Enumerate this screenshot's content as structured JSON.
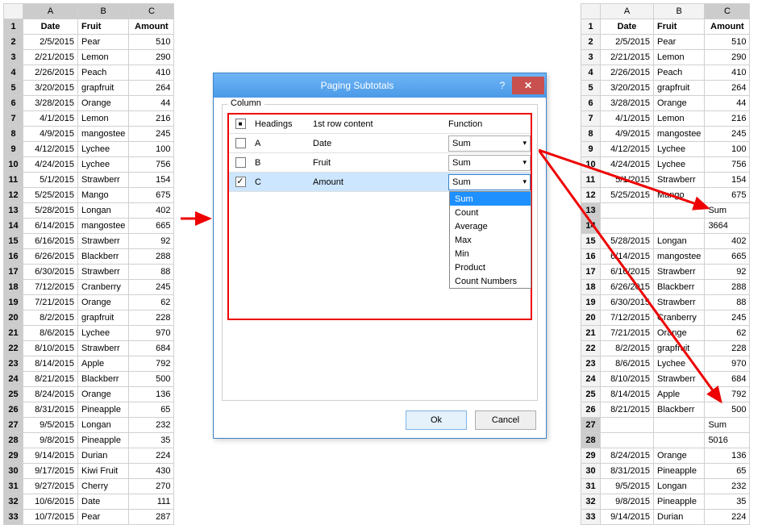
{
  "left_sheet": {
    "columns": [
      "A",
      "B",
      "C"
    ],
    "headers": [
      "Date",
      "Fruit",
      "Amount"
    ],
    "rows": [
      {
        "n": 2,
        "date": "2/5/2015",
        "fruit": "Pear",
        "amount": 510
      },
      {
        "n": 3,
        "date": "2/21/2015",
        "fruit": "Lemon",
        "amount": 290
      },
      {
        "n": 4,
        "date": "2/26/2015",
        "fruit": "Peach",
        "amount": 410
      },
      {
        "n": 5,
        "date": "3/20/2015",
        "fruit": "grapfruit",
        "amount": 264
      },
      {
        "n": 6,
        "date": "3/28/2015",
        "fruit": "Orange",
        "amount": 44
      },
      {
        "n": 7,
        "date": "4/1/2015",
        "fruit": "Lemon",
        "amount": 216
      },
      {
        "n": 8,
        "date": "4/9/2015",
        "fruit": "mangostee",
        "amount": 245
      },
      {
        "n": 9,
        "date": "4/12/2015",
        "fruit": "Lychee",
        "amount": 100
      },
      {
        "n": 10,
        "date": "4/24/2015",
        "fruit": "Lychee",
        "amount": 756
      },
      {
        "n": 11,
        "date": "5/1/2015",
        "fruit": "Strawberr",
        "amount": 154
      },
      {
        "n": 12,
        "date": "5/25/2015",
        "fruit": "Mango",
        "amount": 675
      },
      {
        "n": 13,
        "date": "5/28/2015",
        "fruit": "Longan",
        "amount": 402
      },
      {
        "n": 14,
        "date": "6/14/2015",
        "fruit": "mangostee",
        "amount": 665
      },
      {
        "n": 15,
        "date": "6/16/2015",
        "fruit": "Strawberr",
        "amount": 92
      },
      {
        "n": 16,
        "date": "6/26/2015",
        "fruit": "Blackberr",
        "amount": 288
      },
      {
        "n": 17,
        "date": "6/30/2015",
        "fruit": "Strawberr",
        "amount": 88
      },
      {
        "n": 18,
        "date": "7/12/2015",
        "fruit": "Cranberry",
        "amount": 245
      },
      {
        "n": 19,
        "date": "7/21/2015",
        "fruit": "Orange",
        "amount": 62
      },
      {
        "n": 20,
        "date": "8/2/2015",
        "fruit": "grapfruit",
        "amount": 228
      },
      {
        "n": 21,
        "date": "8/6/2015",
        "fruit": "Lychee",
        "amount": 970
      },
      {
        "n": 22,
        "date": "8/10/2015",
        "fruit": "Strawberr",
        "amount": 684
      },
      {
        "n": 23,
        "date": "8/14/2015",
        "fruit": "Apple",
        "amount": 792
      },
      {
        "n": 24,
        "date": "8/21/2015",
        "fruit": "Blackberr",
        "amount": 500
      },
      {
        "n": 25,
        "date": "8/24/2015",
        "fruit": "Orange",
        "amount": 136
      },
      {
        "n": 26,
        "date": "8/31/2015",
        "fruit": "Pineapple",
        "amount": 65
      },
      {
        "n": 27,
        "date": "9/5/2015",
        "fruit": "Longan",
        "amount": 232
      },
      {
        "n": 28,
        "date": "9/8/2015",
        "fruit": "Pineapple",
        "amount": 35
      },
      {
        "n": 29,
        "date": "9/14/2015",
        "fruit": "Durian",
        "amount": 224
      },
      {
        "n": 30,
        "date": "9/17/2015",
        "fruit": "Kiwi Fruit",
        "amount": 430
      },
      {
        "n": 31,
        "date": "9/27/2015",
        "fruit": "Cherry",
        "amount": 270
      },
      {
        "n": 32,
        "date": "10/6/2015",
        "fruit": "Date",
        "amount": 111
      },
      {
        "n": 33,
        "date": "10/7/2015",
        "fruit": "Pear",
        "amount": 287
      }
    ]
  },
  "right_sheet": {
    "columns": [
      "A",
      "B",
      "C"
    ],
    "headers": [
      "Date",
      "Fruit",
      "Amount"
    ],
    "rows": [
      {
        "n": 2,
        "date": "2/5/2015",
        "fruit": "Pear",
        "amount": "510"
      },
      {
        "n": 3,
        "date": "2/21/2015",
        "fruit": "Lemon",
        "amount": "290"
      },
      {
        "n": 4,
        "date": "2/26/2015",
        "fruit": "Peach",
        "amount": "410"
      },
      {
        "n": 5,
        "date": "3/20/2015",
        "fruit": "grapfruit",
        "amount": "264"
      },
      {
        "n": 6,
        "date": "3/28/2015",
        "fruit": "Orange",
        "amount": "44"
      },
      {
        "n": 7,
        "date": "4/1/2015",
        "fruit": "Lemon",
        "amount": "216"
      },
      {
        "n": 8,
        "date": "4/9/2015",
        "fruit": "mangostee",
        "amount": "245"
      },
      {
        "n": 9,
        "date": "4/12/2015",
        "fruit": "Lychee",
        "amount": "100"
      },
      {
        "n": 10,
        "date": "4/24/2015",
        "fruit": "Lychee",
        "amount": "756"
      },
      {
        "n": 11,
        "date": "5/1/2015",
        "fruit": "Strawberr",
        "amount": "154"
      },
      {
        "n": 12,
        "date": "5/25/2015",
        "fruit": "Mango",
        "amount": "675"
      },
      {
        "n": 13,
        "date": "",
        "fruit": "",
        "amount": "Sum",
        "sum": true
      },
      {
        "n": 14,
        "date": "",
        "fruit": "",
        "amount": "3664",
        "sum": true
      },
      {
        "n": 15,
        "date": "5/28/2015",
        "fruit": "Longan",
        "amount": "402"
      },
      {
        "n": 16,
        "date": "6/14/2015",
        "fruit": "mangostee",
        "amount": "665"
      },
      {
        "n": 17,
        "date": "6/16/2015",
        "fruit": "Strawberr",
        "amount": "92"
      },
      {
        "n": 18,
        "date": "6/26/2015",
        "fruit": "Blackberr",
        "amount": "288"
      },
      {
        "n": 19,
        "date": "6/30/2015",
        "fruit": "Strawberr",
        "amount": "88"
      },
      {
        "n": 20,
        "date": "7/12/2015",
        "fruit": "Cranberry",
        "amount": "245"
      },
      {
        "n": 21,
        "date": "7/21/2015",
        "fruit": "Orange",
        "amount": "62"
      },
      {
        "n": 22,
        "date": "8/2/2015",
        "fruit": "grapfruit",
        "amount": "228"
      },
      {
        "n": 23,
        "date": "8/6/2015",
        "fruit": "Lychee",
        "amount": "970"
      },
      {
        "n": 24,
        "date": "8/10/2015",
        "fruit": "Strawberr",
        "amount": "684"
      },
      {
        "n": 25,
        "date": "8/14/2015",
        "fruit": "Apple",
        "amount": "792"
      },
      {
        "n": 26,
        "date": "8/21/2015",
        "fruit": "Blackberr",
        "amount": "500"
      },
      {
        "n": 27,
        "date": "",
        "fruit": "",
        "amount": "Sum",
        "sum": true
      },
      {
        "n": 28,
        "date": "",
        "fruit": "",
        "amount": "5016",
        "sum": true
      },
      {
        "n": 29,
        "date": "8/24/2015",
        "fruit": "Orange",
        "amount": "136"
      },
      {
        "n": 30,
        "date": "8/31/2015",
        "fruit": "Pineapple",
        "amount": "65"
      },
      {
        "n": 31,
        "date": "9/5/2015",
        "fruit": "Longan",
        "amount": "232"
      },
      {
        "n": 32,
        "date": "9/8/2015",
        "fruit": "Pineapple",
        "amount": "35"
      },
      {
        "n": 33,
        "date": "9/14/2015",
        "fruit": "Durian",
        "amount": "224"
      }
    ]
  },
  "dialog": {
    "title": "Paging Subtotals",
    "group_label": "Column",
    "grid_headers": {
      "headings": "Headings",
      "content": "1st row content",
      "fn": "Function"
    },
    "rows": [
      {
        "col": "A",
        "content": "Date",
        "fn": "Sum",
        "checked": false
      },
      {
        "col": "B",
        "content": "Fruit",
        "fn": "Sum",
        "checked": false
      },
      {
        "col": "C",
        "content": "Amount",
        "fn": "Sum",
        "checked": true,
        "selected": true,
        "open": true
      }
    ],
    "dropdown_options": [
      "Sum",
      "Count",
      "Average",
      "Max",
      "Min",
      "Product",
      "Count Numbers"
    ],
    "ok": "Ok",
    "cancel": "Cancel"
  }
}
